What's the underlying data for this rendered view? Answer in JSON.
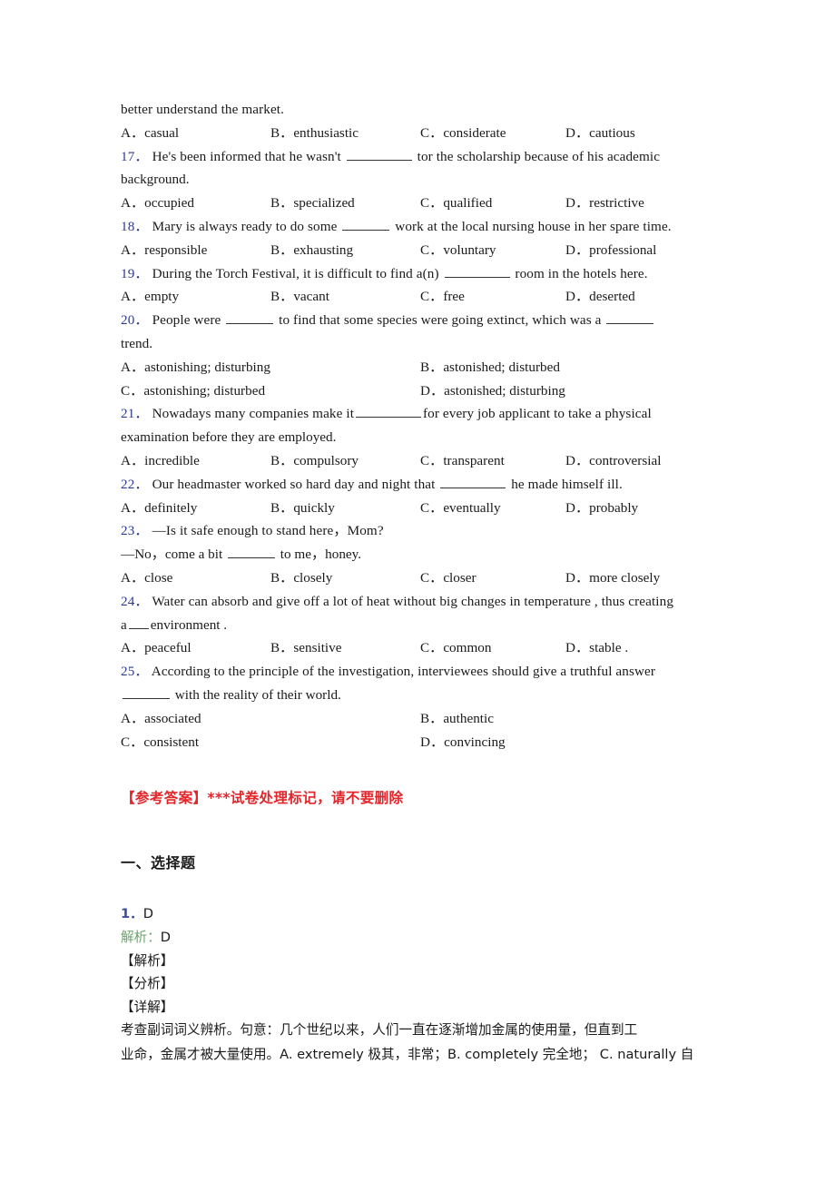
{
  "page": {
    "continuation_line": "better understand the market."
  },
  "questions": [
    {
      "number": "",
      "stem": "",
      "stem_cont": "",
      "layout": "4col",
      "options": [
        "A．casual",
        "B．enthusiastic",
        "C．considerate",
        "D．cautious"
      ]
    },
    {
      "number": "17．",
      "stem_pre": "He's been informed that he wasn't ",
      "stem_post": " tor the scholarship because of his academic",
      "stem_cont": "background.",
      "layout": "4col",
      "options": [
        "A．occupied",
        "B．specialized",
        "C．qualified",
        "D．restrictive"
      ]
    },
    {
      "number": "18．",
      "stem_pre": "Mary is always ready to do some ",
      "stem_post": " work at the local nursing house in her spare time.",
      "stem_cont": "",
      "layout": "4col",
      "options": [
        "A．responsible",
        "B．exhausting",
        "C．voluntary",
        "D．professional"
      ]
    },
    {
      "number": "19．",
      "stem_pre": "During the Torch Festival, it is difficult to find a(n) ",
      "stem_post": " room in the hotels here.",
      "stem_cont": "",
      "layout": "4col",
      "options": [
        "A．empty",
        "B．vacant",
        "C．free",
        "D．deserted"
      ]
    },
    {
      "number": "20．",
      "stem_pre": "People were ",
      "stem_mid": " to find that some species were going extinct, which was a ",
      "stem_post": "",
      "stem_cont": "trend.",
      "layout": "2col",
      "options": [
        "A．astonishing; disturbing",
        "B．astonished; disturbed",
        "C．astonishing; disturbed",
        "D．astonished; disturbing"
      ]
    },
    {
      "number": "21．",
      "stem_pre": "Nowadays many companies make it",
      "stem_post": "for every job applicant to take a physical",
      "stem_cont": "examination before they are employed.",
      "layout": "4col",
      "options": [
        "A．incredible",
        "B．compulsory",
        "C．transparent",
        "D．controversial"
      ]
    },
    {
      "number": "22．",
      "stem_pre": "Our headmaster worked so hard day and night that ",
      "stem_post": " he made himself ill.",
      "stem_cont": "",
      "layout": "4col",
      "options": [
        "A．definitely",
        "B．quickly",
        "C．eventually",
        "D．probably"
      ]
    },
    {
      "number": "23．",
      "stem_pre": "—Is it safe enough to stand here，Mom?",
      "stem_post": "",
      "stem_cont_pre": "—No，come a bit ",
      "stem_cont_post": " to me，honey.",
      "layout": "4col",
      "options": [
        "A．close",
        "B．closely",
        "C．closer",
        "D．more closely"
      ]
    },
    {
      "number": "24．",
      "stem_pre": "Water can absorb and give off a lot of heat without big changes in temperature , thus creating",
      "stem_post": "",
      "stem_cont_pre": "a",
      "stem_cont_post": "environment .",
      "layout": "4col",
      "options": [
        "A．peaceful",
        "B．sensitive",
        "C．common",
        "D．stable ."
      ]
    },
    {
      "number": "25．",
      "stem_pre": "According to the principle of the investigation, interviewees should give a truthful answer",
      "stem_post": "",
      "stem_cont_post": " with the reality of their world.",
      "layout": "2col",
      "options": [
        "A．associated",
        "B．authentic",
        "C．consistent",
        "D．convincing"
      ]
    }
  ],
  "marker": {
    "text": "【参考答案】***试卷处理标记，请不要删除",
    "color": "#e3262b"
  },
  "answers": {
    "section_heading": "一、选择题",
    "item_number": "1．",
    "item_value": "D",
    "analysis_label": "解析：",
    "analysis_value": "D",
    "analysis_color": "#6aa56a",
    "brackets": [
      "【解析】",
      "【分析】",
      "【详解】"
    ],
    "explanation_line1": "考查副词词义辨析。句意：几个世纪以来，人们一直在逐渐增加金属的使用量，但直到工",
    "explanation_line2": "业命，金属才被大量使用。A. extremely 极其，非常；B. completely 完全地； C. naturally 自"
  }
}
